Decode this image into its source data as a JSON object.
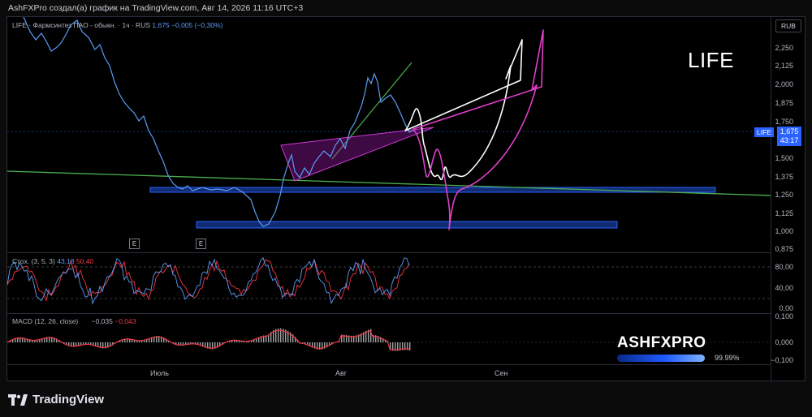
{
  "caption": "AshFXPro создал(а) график на TradingView.com, Авг 14, 2026 11:16 UTC+3",
  "colors": {
    "price_line": "#5b9cf6",
    "trend_green": "#4caf50",
    "pink_arrow": "#e040c8",
    "zone_blue": "#2962ff",
    "stoch_k": "#5b9cf6",
    "stoch_d": "#f23645",
    "macd_red": "#f23645"
  },
  "legend": {
    "symbol": "LIFE · Фармсинтез ПАО - обыкн. · 1ч · RUS",
    "price": "1,675",
    "change": "−0,005 (−0,30%)"
  },
  "big_symbol": "LIFE",
  "currency": "RUB",
  "price_tag": {
    "symbol": "LIFE",
    "price": "1,675",
    "countdown": "43:17"
  },
  "price_axis": [
    "2,250",
    "2,125",
    "2,000",
    "1,875",
    "1,750",
    "1,500",
    "1,375",
    "1,250",
    "1,125",
    "1,000",
    "0,875"
  ],
  "stoch": {
    "label": "Стох. (3, 5, 3)",
    "k": "43,18",
    "d": "50,40",
    "axis": [
      "80,00",
      "40,00",
      "0,00"
    ]
  },
  "macd": {
    "label": "MACD (12, 26, close)",
    "macd_value": "−0,035",
    "signal_value": "−0,043",
    "axis": [
      "0,100",
      "0,000",
      "−0,100"
    ]
  },
  "time_axis": [
    "Июль",
    "Авг",
    "Сен"
  ],
  "earnings_marker": "E",
  "brand": {
    "name": "ASHFXPRO",
    "percent": "99.99%"
  },
  "footer": {
    "brand": "TradingView"
  },
  "chart_data": [
    {
      "type": "line",
      "name": "LIFE",
      "ylim": [
        0.875,
        2.3
      ],
      "x_index": [
        0,
        6,
        12,
        18,
        24,
        30,
        36,
        42,
        48,
        54,
        60,
        66,
        72,
        78,
        84,
        90,
        96,
        102,
        108,
        114,
        120,
        126,
        132,
        138,
        144,
        150,
        156,
        162
      ],
      "values": [
        2.3,
        2.28,
        2.25,
        2.15,
        2.0,
        1.85,
        1.7,
        1.55,
        1.42,
        1.32,
        1.29,
        1.29,
        1.28,
        1.27,
        1.1,
        1.02,
        1.25,
        1.38,
        1.42,
        1.48,
        1.6,
        1.72,
        1.9,
        2.05,
        1.95,
        1.9,
        1.78,
        1.675
      ],
      "annotations": [
        "E",
        "E"
      ]
    },
    {
      "type": "line",
      "name": "Стох.",
      "ylim": [
        0,
        100
      ],
      "series": [
        {
          "name": "%K",
          "value": 43.18
        },
        {
          "name": "%D",
          "value": 50.4
        }
      ]
    },
    {
      "type": "bar",
      "name": "MACD",
      "ylim": [
        -0.1,
        0.1
      ],
      "series": [
        {
          "name": "MACD",
          "value": -0.035
        },
        {
          "name": "signal",
          "value": -0.043
        }
      ]
    }
  ]
}
